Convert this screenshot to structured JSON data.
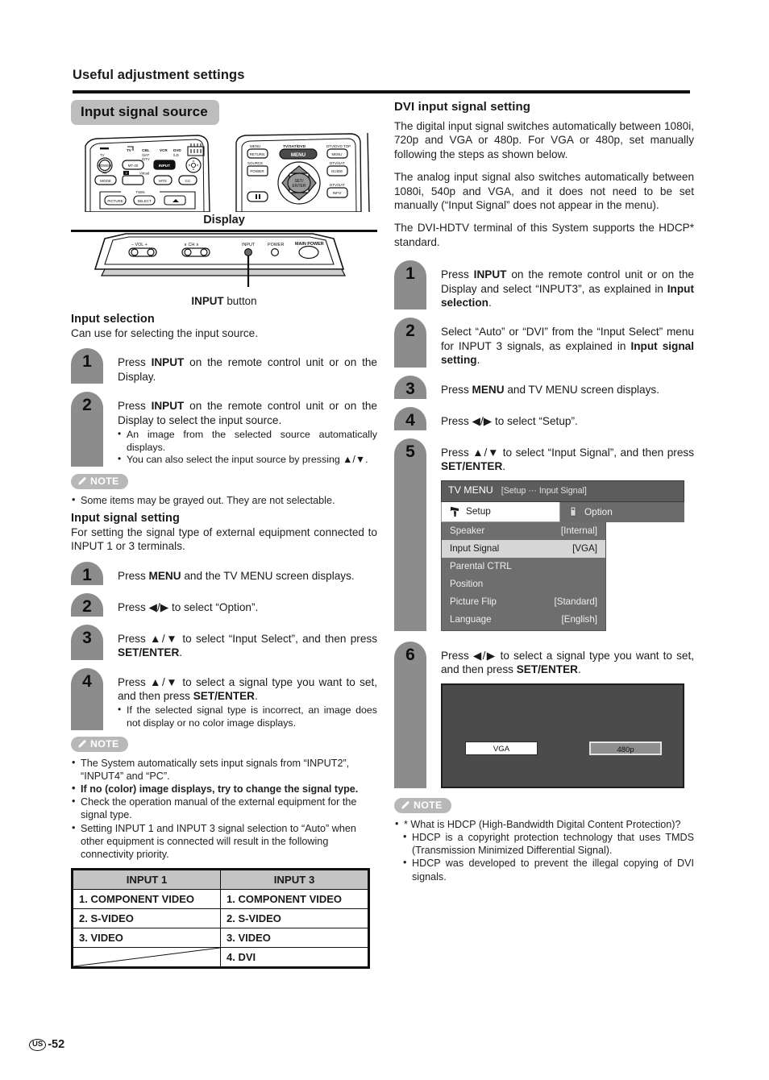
{
  "header": {
    "title": "Useful adjustment settings"
  },
  "section": {
    "pill_label": "Input signal source"
  },
  "diagrams": {
    "display_label": "Display",
    "input_button_caption_bold": "INPUT",
    "input_button_caption_rest": " button",
    "remote_left_labels": [
      "TV",
      "TV",
      "CBL",
      "VCR",
      "DVD",
      "/SAT",
      "/LD",
      "/DTV",
      "POWER",
      "MT-40",
      "INPUT",
      "AV",
      "Virtual",
      "MODE",
      "MTS",
      "CC",
      "TWIN",
      "PICTURE",
      "SELECT"
    ],
    "remote_right_labels": [
      "MENU",
      "TV/SAT/DVD",
      "DTV/DVD TOP",
      "RETURN",
      "MENU",
      "MENU",
      "SOURCE",
      "DTV/SAT",
      "POWER",
      "GUIDE",
      "SET/",
      "ENTER",
      "DTV/SAT",
      "INFO"
    ],
    "display_panel_labels": [
      "- VOL +",
      "CH",
      "INPUT",
      "POWER",
      "MAIN POWER"
    ]
  },
  "left": {
    "input_selection": {
      "heading": "Input selection",
      "intro": "Can use for selecting the input source.",
      "steps": [
        {
          "num": "1",
          "pre": "Press ",
          "bold": "INPUT",
          "post": " on the remote control unit or on the Display.",
          "bullets": []
        },
        {
          "num": "2",
          "pre": "Press ",
          "bold": "INPUT",
          "post": " on the remote control unit or on the Display to select the input source.",
          "bullets": [
            "An image from the selected source automatically displays.",
            "You can also select the input source by pressing ▲/▼."
          ]
        }
      ],
      "note_label": "NOTE",
      "notes": [
        {
          "text": "Some items may be grayed out. They are not selectable.",
          "bold": false
        }
      ]
    },
    "input_signal_setting": {
      "heading": "Input signal setting",
      "intro": "For setting the signal type of external equipment connected to INPUT 1 or 3 terminals.",
      "steps": [
        {
          "num": "1",
          "pre": "Press ",
          "bold": "MENU",
          "post": " and the TV MENU screen displays.",
          "bullets": []
        },
        {
          "num": "2",
          "pre": "Press ◀/▶ to select “Option”.",
          "bold": "",
          "post": "",
          "bullets": []
        },
        {
          "num": "3",
          "pre": "Press ▲/▼ to select “Input Select”, and then press ",
          "bold": "SET/ENTER",
          "post": ".",
          "bullets": []
        },
        {
          "num": "4",
          "pre": "Press ▲/▼ to select a signal type you want to set, and then press ",
          "bold": "SET/ENTER",
          "post": ".",
          "bullets": [
            "If the selected signal type is incorrect, an image does not display or no color image displays."
          ]
        }
      ],
      "note_label": "NOTE",
      "notes": [
        {
          "text": "The System automatically sets input signals from “INPUT2”, “INPUT4” and “PC”.",
          "bold": false
        },
        {
          "text": "If no (color) image displays, try to change the signal type.",
          "bold": true
        },
        {
          "text": "Check the operation manual of the external equipment for the signal type.",
          "bold": false
        },
        {
          "text": "Setting INPUT 1 and INPUT 3 signal selection to “Auto” when other equipment is connected will result in the following connectivity priority.",
          "bold": false
        }
      ]
    },
    "priority_table": {
      "headers": [
        "INPUT 1",
        "INPUT 3"
      ],
      "rows": [
        [
          "1. COMPONENT VIDEO",
          "1. COMPONENT VIDEO"
        ],
        [
          "2. S-VIDEO",
          "2. S-VIDEO"
        ],
        [
          "3. VIDEO",
          "3. VIDEO"
        ],
        [
          "",
          "4. DVI"
        ]
      ]
    }
  },
  "right": {
    "heading": "DVI input signal setting",
    "paragraphs": [
      "The digital input signal switches automatically between 1080i, 720p and VGA or 480p. For VGA or 480p, set manually following the steps as shown below.",
      "The analog input signal also switches automatically between 1080i, 540p and VGA, and it does not need to be set manually (“Input Signal” does not appear in the menu).",
      "The DVI-HDTV terminal of this System supports the HDCP* standard."
    ],
    "steps": [
      {
        "num": "1",
        "pre": "Press ",
        "bold": "INPUT",
        "post": " on the remote control unit or on the Display and select “INPUT3”, as explained in ",
        "bold2": "Input selection",
        "post2": "."
      },
      {
        "num": "2",
        "pre": "Select “Auto” or “DVI” from the “Input Select” menu for INPUT 3 signals, as explained in ",
        "bold": "",
        "post": "",
        "bold2": "Input signal setting",
        "post2": "."
      },
      {
        "num": "3",
        "pre": "Press ",
        "bold": "MENU",
        "post": " and TV MENU screen displays.",
        "bold2": "",
        "post2": ""
      },
      {
        "num": "4",
        "pre": "Press ◀/▶ to select “Setup”.",
        "bold": "",
        "post": "",
        "bold2": "",
        "post2": ""
      },
      {
        "num": "5",
        "pre": "Press ▲/▼ to select “Input Signal”, and then press ",
        "bold": "SET/ENTER",
        "post": ".",
        "bold2": "",
        "post2": ""
      },
      {
        "num": "6",
        "pre": "Press ◀/▶ to select a signal type you want to set, and then press ",
        "bold": "SET/ENTER",
        "post": ".",
        "bold2": "",
        "post2": ""
      }
    ],
    "tv_menu": {
      "title": "TV MENU",
      "breadcrumb": "[Setup ··· Input Signal]",
      "tabs": [
        {
          "label": "Setup",
          "active": true,
          "icon": "setup-icon"
        },
        {
          "label": "Option",
          "active": false,
          "icon": "option-icon"
        }
      ],
      "rows": [
        {
          "label": "Speaker",
          "value": "[Internal]",
          "selected": false
        },
        {
          "label": "Input Signal",
          "value": "[VGA]",
          "selected": true
        },
        {
          "label": "Parental CTRL",
          "value": "",
          "selected": false
        },
        {
          "label": "Position",
          "value": "",
          "selected": false
        },
        {
          "label": "Picture Flip",
          "value": "[Standard]",
          "selected": false
        },
        {
          "label": "Language",
          "value": "[English]",
          "selected": false
        }
      ]
    },
    "signal_screen": {
      "options": [
        {
          "label": "VGA",
          "selected": true
        },
        {
          "label": "480p",
          "selected": false
        }
      ]
    },
    "note_label": "NOTE",
    "notes_main": "*  What is HDCP (High-Bandwidth Digital Content Protection)?",
    "notes_sub": [
      "HDCP is a copyright protection technology that uses TMDS (Transmission Minimized Differential Signal).",
      "HDCP was developed to prevent the illegal copying of DVI signals."
    ]
  },
  "footer": {
    "region": "US",
    "page": "-52"
  },
  "colors": {
    "pill_bg": "#bdbdbd",
    "step_badge": "#8c8c8c",
    "note_tag": "#b8b8b8",
    "menu_bg": "#6e6e6e",
    "menu_title": "#5c5c5c",
    "menu_selected": "#d6d6d6",
    "screen_bg": "#4b4b4b",
    "table_header": "#c4c4c4",
    "rule": "#111111"
  }
}
